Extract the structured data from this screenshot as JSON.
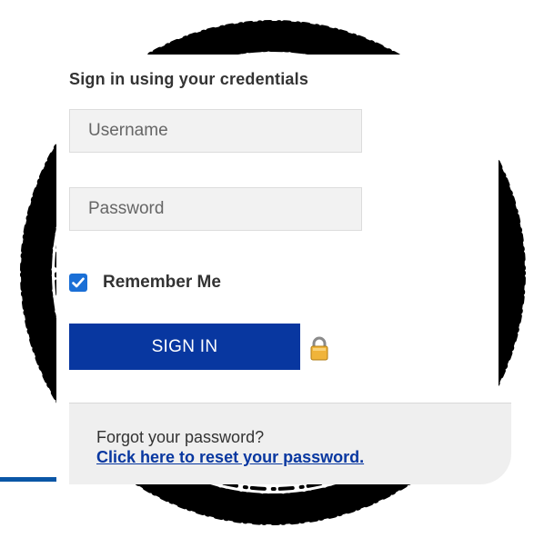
{
  "login": {
    "title": "Sign in using your credentials",
    "username_placeholder": "Username",
    "password_placeholder": "Password",
    "remember_label": "Remember Me",
    "remember_checked": true,
    "signin_label": "SIGN IN",
    "forgot_text": "Forgot your password?",
    "reset_link": "Click here to reset your password."
  },
  "icons": {
    "checkbox": "check-icon",
    "lock": "padlock-icon"
  },
  "colors": {
    "button": "#0837a0",
    "link": "#0837a0",
    "checkbox": "#1a6fd6",
    "field_bg": "#f2f2f2",
    "accent_line": "#0a56a6",
    "brush": "#000000"
  }
}
